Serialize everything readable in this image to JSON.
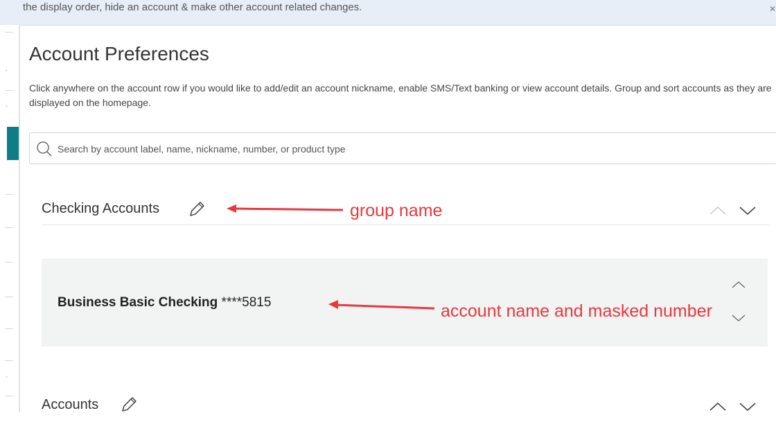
{
  "banner": {
    "text": "the display order, hide an account & make other account related changes.",
    "close_icon": "close-icon"
  },
  "page": {
    "title": "Account Preferences",
    "description": "Click anywhere on the account row if you would like to add/edit an account nickname, enable SMS/Text banking or view account details. Group and sort accounts as they are displayed on the homepage."
  },
  "search": {
    "placeholder": "Search by account label, name, nickname, number, or product type",
    "value": "",
    "icon": "search-icon"
  },
  "groups": [
    {
      "name": "Checking Accounts",
      "accounts": [
        {
          "name": "Business Basic Checking",
          "masked_number": "****5815"
        }
      ]
    },
    {
      "name": "Accounts",
      "accounts": []
    }
  ],
  "annotations": {
    "group_name": "group name",
    "account_name": "account name and masked number",
    "color": "#e8383d"
  },
  "colors": {
    "banner_bg": "#e8eef7",
    "accent": "#0e7d86",
    "row_bg": "#f2f3f3"
  }
}
